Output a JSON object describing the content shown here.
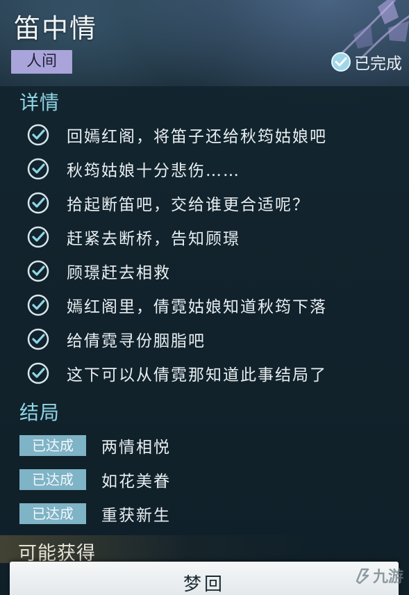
{
  "header": {
    "title": "笛中情",
    "category_tag": "人间",
    "status_label": "已完成",
    "status_icon": "check-circle-icon"
  },
  "details": {
    "section_title": "详情",
    "check_icon": "check-circle-icon",
    "tasks": [
      {
        "text": "回嫣红阁，将笛子还给秋筠姑娘吧",
        "completed": true
      },
      {
        "text": "秋筠姑娘十分悲伤……",
        "completed": true
      },
      {
        "text": "拾起断笛吧，交给谁更合适呢？",
        "completed": true
      },
      {
        "text": "赶紧去断桥，告知顾璟",
        "completed": true
      },
      {
        "text": "顾璟赶去相救",
        "completed": true
      },
      {
        "text": "嫣红阁里，倩霓姑娘知道秋筠下落",
        "completed": true
      },
      {
        "text": "给倩霓寻份胭脂吧",
        "completed": true
      },
      {
        "text": "这下可以从倩霓那知道此事结局了",
        "completed": true
      }
    ]
  },
  "endings": {
    "section_title": "结局",
    "items": [
      {
        "badge": "已达成",
        "text": "两情相悦"
      },
      {
        "badge": "已达成",
        "text": "如花美眷"
      },
      {
        "badge": "已达成",
        "text": "重获新生"
      }
    ]
  },
  "rewards": {
    "section_title": "可能获得"
  },
  "footer": {
    "button_label": "梦回",
    "watermark_text": "九游"
  },
  "colors": {
    "accent_cyan": "#8fd6e6",
    "tag_lavender": "#a9a4da",
    "badge_blue": "#7fb3c6"
  }
}
